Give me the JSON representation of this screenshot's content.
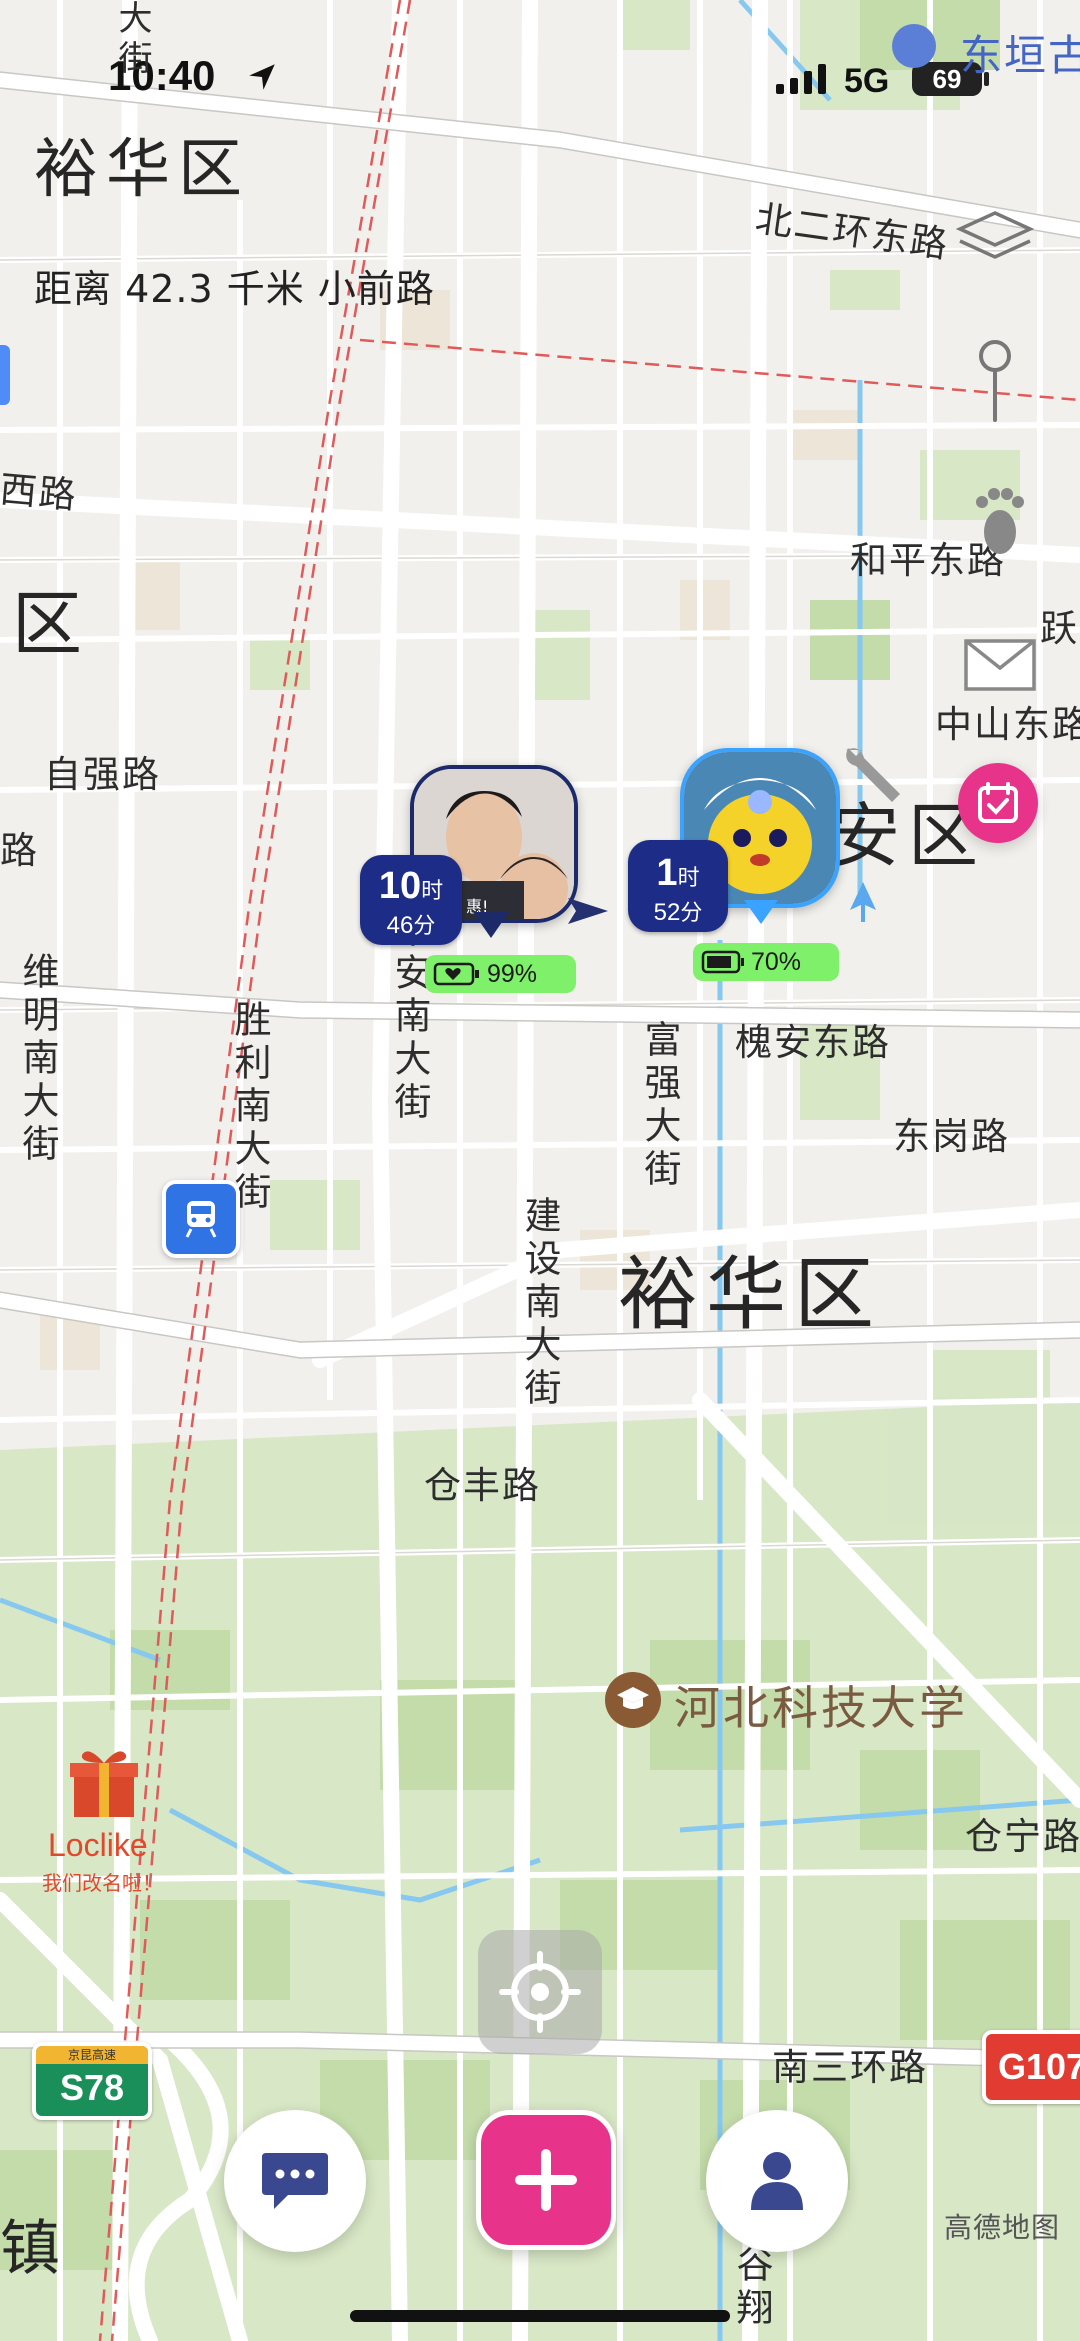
{
  "status_bar": {
    "time": "10:40",
    "network": "5G",
    "battery": "69"
  },
  "header": {
    "district": "裕华区",
    "distance_text": "距离 42.3 千米 小前路"
  },
  "map": {
    "labels": {
      "top_right_poi": "东垣古",
      "bei_er_huan": "北二环东路",
      "xi_road": "西路",
      "left_qu": "区",
      "he_ping": "和平东路",
      "yue": "跃",
      "zhong_shan": "中山东路",
      "zi_qiang": "自强路",
      "left_lu": "路",
      "an_qu": "安区",
      "huai_an": "槐安东路",
      "dong_gang": "东岗路",
      "yuhua_main": "裕华区",
      "cang_feng": "仓丰路",
      "hebei_uni": "河北科技大学",
      "cang_ning": "仓宁路",
      "nan_san_huan": "南三环路",
      "zhen": "镇",
      "weiming": "维明南大街",
      "shengli": "胜利南大街",
      "ping_an": "平安南大街",
      "fu_qiang": "富强大街",
      "jian_she": "建设南大街",
      "gu_xiang": "谷翔",
      "top_left_street": "大街",
      "highway_s78_top": "京昆高速",
      "highway_s78": "S78",
      "highway_g107": "G107",
      "amap_credit": "高德地图"
    },
    "promo": {
      "title": "Loclike",
      "subtitle": "我们改名啦！"
    },
    "person_1": {
      "hours": "10",
      "hours_unit": "时",
      "minutes": "46",
      "minutes_unit": "分",
      "battery": "99%",
      "photo_caption": "惠!"
    },
    "person_2": {
      "hours": "1",
      "hours_unit": "时",
      "minutes": "52",
      "minutes_unit": "分",
      "battery": "70%"
    }
  },
  "toolbar": {
    "layers_icon": "layers-icon",
    "pin_icon": "map-pin-icon",
    "footprint_icon": "footprint-icon",
    "mail_icon": "envelope-icon",
    "calendar_icon": "calendar-check-icon"
  },
  "bottom_bar": {
    "chat_icon": "chat-bubble-icon",
    "add_icon": "plus-icon",
    "profile_icon": "person-icon",
    "locate_icon": "locate-crosshair-icon"
  },
  "colors": {
    "accent_pink": "#e8338a",
    "badge_navy": "#1c2c87",
    "battery_green": "#7ff06a",
    "water_blue": "#7fc4ee",
    "park_green": "#c5e0b0"
  }
}
